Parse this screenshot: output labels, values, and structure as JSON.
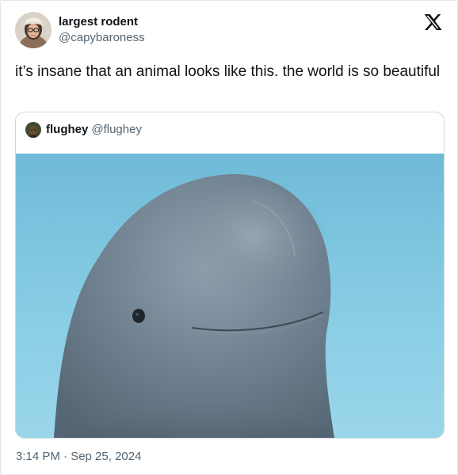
{
  "author": {
    "display_name": "largest rodent",
    "handle": "@capybaroness",
    "avatar_icon": "user-avatar-photo"
  },
  "brand": {
    "logo_icon": "x-logo-icon"
  },
  "tweet": {
    "text": "it’s insane that an animal looks like this. the world is so beautiful",
    "timestamp": "3:14 PM · Sep 25, 2024"
  },
  "quote": {
    "display_name": "flughey",
    "handle": "@flughey",
    "avatar_icon": "user-avatar-photo",
    "media_icon": "beluga-whale-photo"
  },
  "colors": {
    "text_primary": "#0f1419",
    "text_secondary": "#536471",
    "border": "#cfd9de",
    "water": "#7cc3de"
  }
}
